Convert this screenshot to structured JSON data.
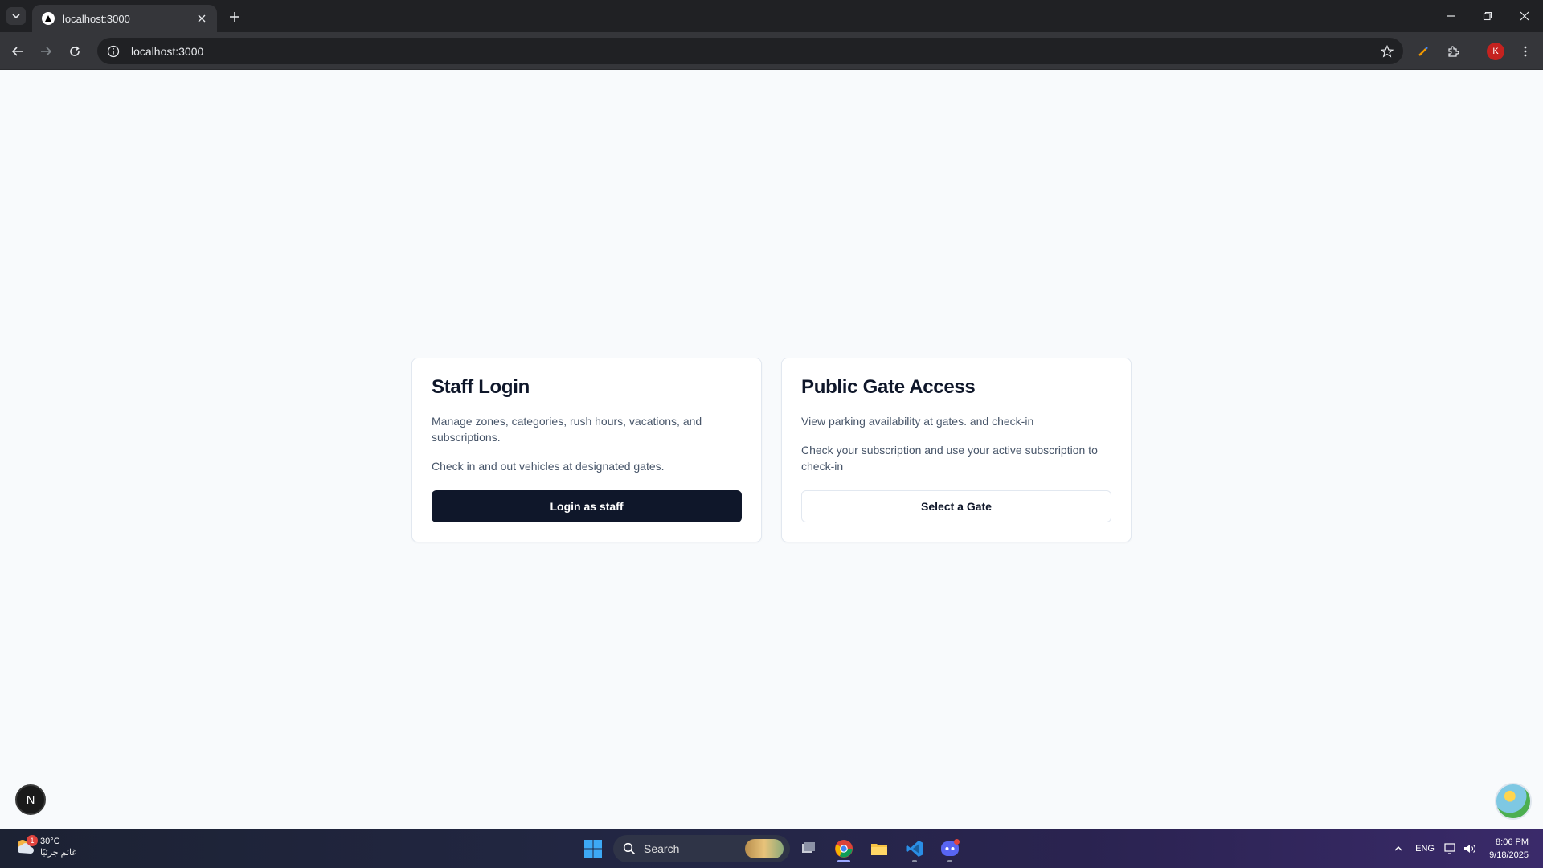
{
  "browser": {
    "tab_title": "localhost:3000",
    "url": "localhost:3000",
    "profile_initial": "K"
  },
  "page": {
    "staff_card": {
      "title": "Staff Login",
      "description_1": "Manage zones, categories, rush hours, vacations, and subscriptions.",
      "description_2": "Check in and out vehicles at designated gates.",
      "button_label": "Login as staff"
    },
    "public_card": {
      "title": "Public Gate Access",
      "description_1": "View parking availability at gates. and check-in",
      "description_2": "Check your subscription and use your active subscription to check-in",
      "button_label": "Select a Gate"
    },
    "dev_badge_letter": "N"
  },
  "taskbar": {
    "weather_temp": "30°C",
    "weather_desc": "غائم جزئيًا",
    "weather_badge": "1",
    "search_label": "Search",
    "language": "ENG",
    "time": "8:06 PM",
    "date": "9/18/2025"
  },
  "colors": {
    "primary_button": "#0f172a",
    "page_background": "#f8fafc",
    "card_border": "#e2e8f0"
  }
}
